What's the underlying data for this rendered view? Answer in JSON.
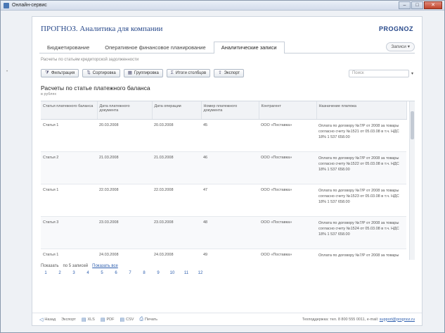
{
  "window": {
    "title": "Онлайн-сервис",
    "controls": [
      "–",
      "□",
      "✕"
    ]
  },
  "header": {
    "product": "ПРОГНОЗ. Аналитика для компании",
    "logo": "PROGNOZ"
  },
  "tabs": [
    {
      "label": "Бюджетирование",
      "active": false
    },
    {
      "label": "Оперативное финансовое планирование",
      "active": false
    },
    {
      "label": "Аналитические записи",
      "active": true
    },
    {
      "label": "",
      "active": false
    }
  ],
  "tab_more": "Записи",
  "subline": "Расчеты по статьям кредиторской задолженности",
  "toolbar": {
    "buttons": [
      {
        "icon": "filter-icon",
        "glyph": "⧩",
        "label": "Фильтрация"
      },
      {
        "icon": "sort-icon",
        "glyph": "⇅",
        "label": "Сортировка"
      },
      {
        "icon": "columns-icon",
        "glyph": "▦",
        "label": "Группировка"
      },
      {
        "icon": "totals-icon",
        "glyph": "Σ",
        "label": "Итоги столбцов"
      },
      {
        "icon": "export-icon",
        "glyph": "⇪",
        "label": "Экспорт"
      }
    ],
    "search_placeholder": "Поиск",
    "search_dropdown": "▾"
  },
  "report": {
    "title": "Расчеты по статье платежного баланса",
    "subtitle": "в рублях"
  },
  "table": {
    "columns": [
      "Статья платежного баланса",
      "Дата платежного документа",
      "Дата операции",
      "Номер платежного документа",
      "Контрагент",
      "Назначение платежа"
    ],
    "rows": [
      [
        "Статья 1",
        "20.03.2008",
        "20.03.2008",
        "45",
        "ООО «Поставка»",
        "Оплата по договору №7/Р от 2008 за товары согласно счету №1521 от 05.03.08 в т.ч. НДС 18% 1 537 658.00"
      ],
      [
        "Статья 2",
        "21.03.2008",
        "21.03.2008",
        "46",
        "ООО «Поставка»",
        "Оплата по договору №7/Р от 2008 за товары согласно счету №1522 от 05.03.08 в т.ч. НДС 18% 1 537 658.00"
      ],
      [
        "Статья 1",
        "22.03.2008",
        "22.03.2008",
        "47",
        "ООО «Поставка»",
        "Оплата по договору №7/Р от 2008 за товары согласно счету №1523 от 05.03.08 в т.ч. НДС 18% 1 537 658.00"
      ],
      [
        "Статья 3",
        "23.03.2008",
        "23.03.2008",
        "48",
        "ООО «Поставка»",
        "Оплата по договору №7/Р от 2008 за товары согласно счету №1524 от 05.03.08 в т.ч. НДС 18% 1 537 658.00"
      ],
      [
        "Статья 1",
        "24.03.2008",
        "24.03.2008",
        "49",
        "ООО «Поставка»",
        "Оплата по договору №7/Р от 2008 за товары"
      ]
    ]
  },
  "pager": {
    "label": "Показать",
    "per_page": "по 5 записей",
    "show_all": "Показать все",
    "pages": [
      "1",
      "2",
      "3",
      "4",
      "5",
      "6",
      "7",
      "8",
      "9",
      "10",
      "11",
      "12"
    ]
  },
  "footer": {
    "items": [
      {
        "icon": "back-icon",
        "glyph": "◁",
        "label": "Назад"
      },
      {
        "icon": "export-icon",
        "glyph": "",
        "label": "Экспорт"
      },
      {
        "icon": "xls-icon",
        "glyph": "▤",
        "label": "XLS"
      },
      {
        "icon": "pdf-icon",
        "glyph": "▤",
        "label": "PDF"
      },
      {
        "icon": "csv-icon",
        "glyph": "▤",
        "label": "CSV"
      },
      {
        "icon": "print-icon",
        "glyph": "⎙",
        "label": "Печать"
      }
    ],
    "support_text": "Техподдержка: тел. 8 800 555 0011, e-mail:",
    "support_email": "support@prognoz.ru"
  }
}
